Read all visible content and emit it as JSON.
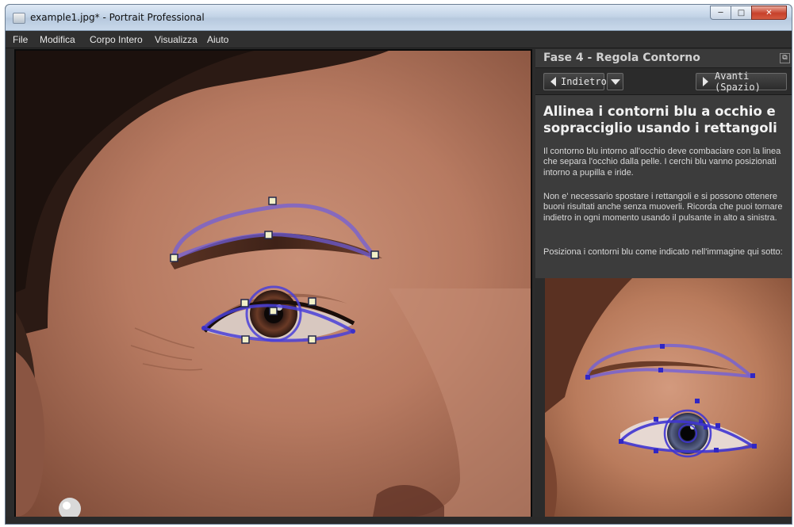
{
  "window": {
    "title": "example1.jpg* - Portrait Professional",
    "controls": {
      "minimize_icon": "minimize-icon",
      "maximize_icon": "maximize-icon",
      "close_icon": "close-icon"
    }
  },
  "menu": [
    "File",
    "Modifica",
    "Corpo Intero",
    "Visualizza",
    "Aiuto"
  ],
  "panel": {
    "title": "Fase 4 - Regola Contorno",
    "back_label": "Indietro",
    "next_label": "Avanti (Spazio)",
    "heading": "Allinea i contorni blu a occhio e sopracciglio usando i rettangoli",
    "paragraphs": [
      "Il contorno blu intorno all'occhio deve combaciare con la linea che separa l'occhio dalla pelle. I cerchi blu vanno posizionati intorno a pupilla e iride.",
      "Non e' necessario spostare i rettangoli e si possono ottenere buoni risultati anche senza muoverli. Ricorda che puoi tornare indietro in ogni momento usando il pulsante in alto a sinistra.",
      "Posiziona i contorni blu come indicato nell'immagine qui sotto:"
    ]
  },
  "colors": {
    "contour": "#5a4fd0",
    "handle_fill": "#f1f0c8",
    "panel_bg": "#3c3c3c",
    "app_bg": "#2c2c2c"
  }
}
